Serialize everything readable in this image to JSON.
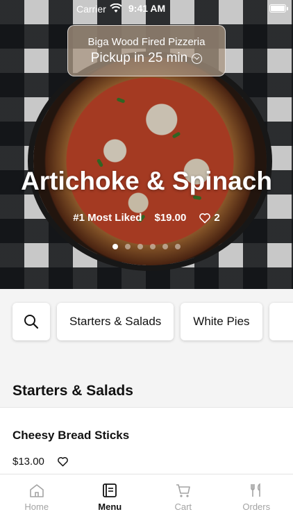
{
  "status_bar": {
    "carrier": "Carrier",
    "time": "9:41 AM"
  },
  "pickup": {
    "restaurant": "Biga Wood Fired Pizzeria",
    "time_label": "Pickup in 25 min"
  },
  "hero": {
    "title": "Artichoke & Spinach",
    "rank_label": "#1 Most Liked",
    "price": "$19.00",
    "likes": "2",
    "slides_total": 6,
    "active_slide": 1
  },
  "categories": {
    "chips": [
      "Starters & Salads",
      "White Pies"
    ]
  },
  "section": {
    "title": "Starters & Salads"
  },
  "items": [
    {
      "name": "Cheesy Bread Sticks",
      "price": "$13.00"
    }
  ],
  "tabs": [
    {
      "label": "Home",
      "icon": "home-icon"
    },
    {
      "label": "Menu",
      "icon": "menu-icon"
    },
    {
      "label": "Cart",
      "icon": "cart-icon"
    },
    {
      "label": "Orders",
      "icon": "utensils-icon"
    }
  ],
  "colors": {
    "active_tab": "#111111",
    "inactive_tab": "#a3a3a3",
    "section_bg": "#f4f4f4"
  }
}
